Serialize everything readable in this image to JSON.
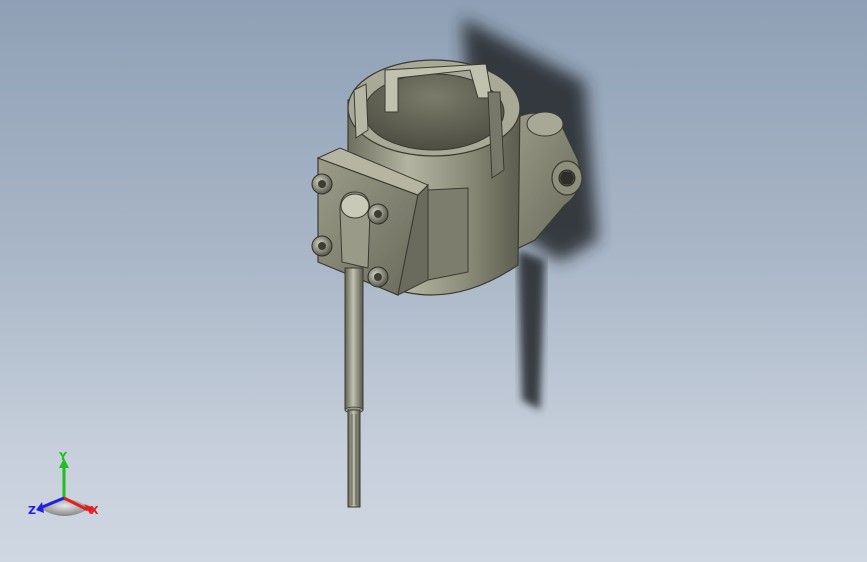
{
  "viewport": {
    "background_top": "#8fa0b6",
    "background_bottom": "#cfd7e2"
  },
  "model": {
    "body_color": "#8d8d7c",
    "shadow_color": "#2b2f34"
  },
  "triad": {
    "x_label": "X",
    "y_label": "Y",
    "z_label": "Z",
    "x_color": "#e02020",
    "y_color": "#20c020",
    "z_color": "#2020e0"
  }
}
